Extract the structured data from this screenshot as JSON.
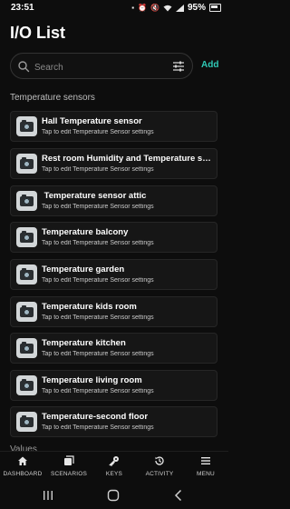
{
  "status_bar": {
    "time": "23:51",
    "battery": "95%",
    "icons": [
      "sim-icon",
      "alarm-icon",
      "mute-icon",
      "wifi-icon",
      "signal-icon",
      "battery-icon"
    ]
  },
  "page": {
    "title": "I/O List"
  },
  "search": {
    "placeholder": "Search",
    "value": ""
  },
  "add_label": "Add",
  "section": {
    "label": "Temperature sensors"
  },
  "items": [
    {
      "title": "Hall Temperature sensor",
      "subtitle": "Tap to edit Temperature Sensor settings"
    },
    {
      "title": "Rest room Humidity and Temperature se...",
      "subtitle": "Tap to edit Temperature Sensor settings"
    },
    {
      "title": " Temperature sensor attic",
      "subtitle": "Tap to edit Temperature Sensor settings"
    },
    {
      "title": "Temperature balcony",
      "subtitle": "Tap to edit Temperature Sensor settings"
    },
    {
      "title": "Temperature garden",
      "subtitle": "Tap to edit Temperature Sensor settings"
    },
    {
      "title": "Temperature kids room",
      "subtitle": "Tap to edit Temperature Sensor settings"
    },
    {
      "title": "Temperature kitchen",
      "subtitle": "Tap to edit Temperature Sensor settings"
    },
    {
      "title": "Temperature living room",
      "subtitle": "Tap to edit Temperature Sensor settings"
    },
    {
      "title": "Temperature-second floor",
      "subtitle": "Tap to edit Temperature Sensor settings"
    }
  ],
  "next_section_label": "Values",
  "bottom_nav": [
    {
      "label": "DASHBOARD",
      "icon": "home-icon"
    },
    {
      "label": "SCENARIOS",
      "icon": "scenarios-icon"
    },
    {
      "label": "KEYS",
      "icon": "key-icon"
    },
    {
      "label": "ACTIVITY",
      "icon": "history-icon"
    },
    {
      "label": "MENU",
      "icon": "menu-icon"
    }
  ],
  "colors": {
    "accent": "#2fc9b6",
    "background": "#0d0d0d",
    "card": "#161616"
  }
}
